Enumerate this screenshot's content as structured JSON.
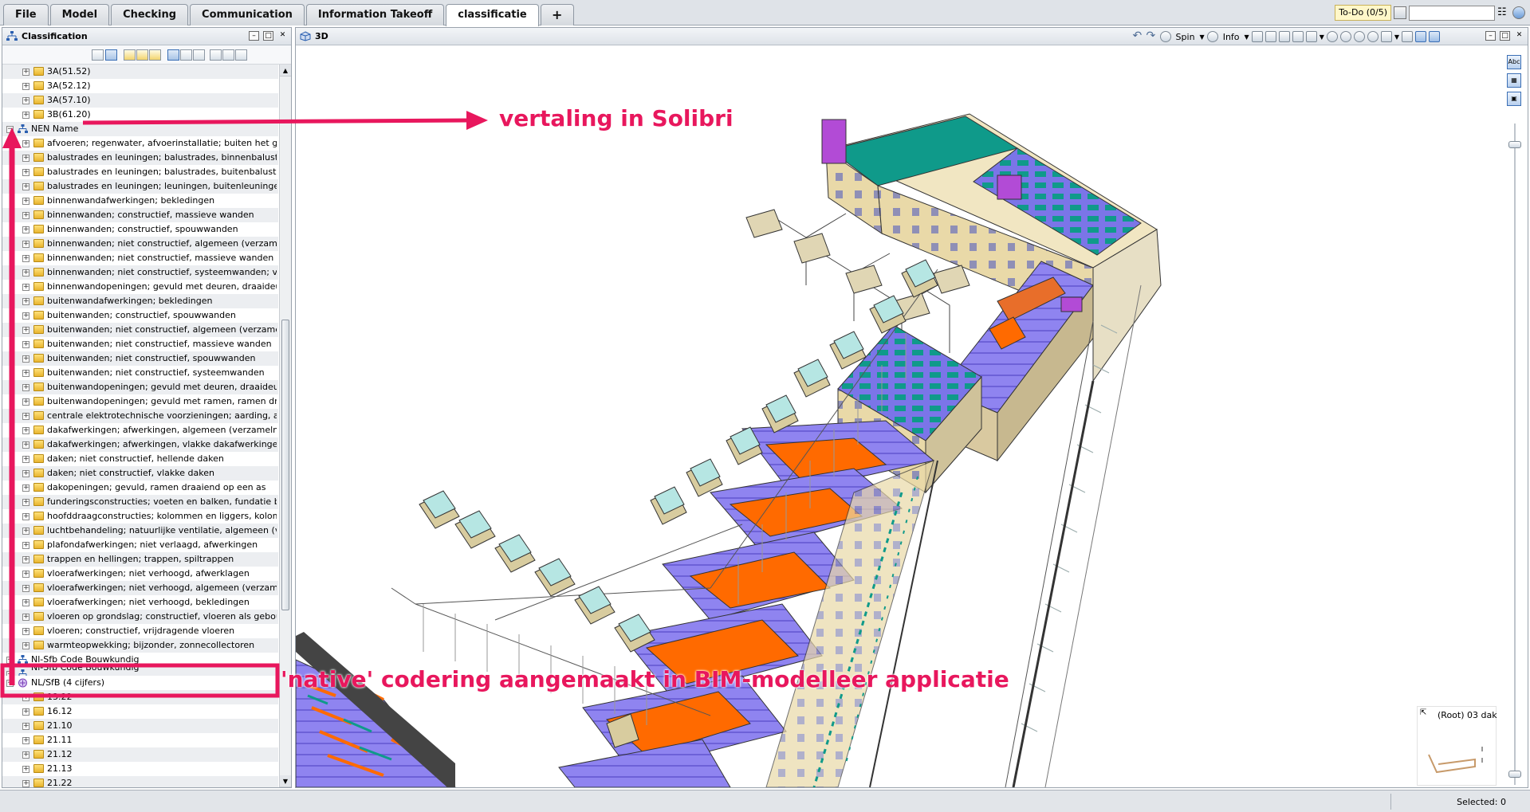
{
  "tabs": [
    {
      "label": "File"
    },
    {
      "label": "Model"
    },
    {
      "label": "Checking"
    },
    {
      "label": "Communication"
    },
    {
      "label": "Information Takeoff"
    },
    {
      "label": "classificatie"
    },
    {
      "label": "+"
    }
  ],
  "active_tab": "classificatie",
  "topright": {
    "todo_label": "To-Do (0/5)",
    "search_value": ""
  },
  "left_panel": {
    "title": "Classification"
  },
  "view_panel": {
    "title": "3D",
    "spin_label": "Spin",
    "info_label": "Info",
    "minimap_label": "(Root) 03 dak"
  },
  "tree": [
    {
      "level": 1,
      "label": "3A(51.52)",
      "type": "folder"
    },
    {
      "level": 1,
      "label": "3A(52.12)",
      "type": "folder"
    },
    {
      "level": 1,
      "label": "3A(57.10)",
      "type": "folder"
    },
    {
      "level": 1,
      "label": "3B(61.20)",
      "type": "folder"
    },
    {
      "level": 0,
      "label": "NEN Name",
      "type": "classification",
      "expanded": true
    },
    {
      "level": 1,
      "label": "afvoeren; regenwater, afvoerinstallatie; buiten het geb",
      "type": "folder"
    },
    {
      "level": 1,
      "label": "balustrades en leuningen; balustrades, binnenbalustrad",
      "type": "folder"
    },
    {
      "level": 1,
      "label": "balustrades en leuningen; balustrades, buitenbalustrad",
      "type": "folder"
    },
    {
      "level": 1,
      "label": "balustrades en leuningen; leuningen, buitenleuningen",
      "type": "folder"
    },
    {
      "level": 1,
      "label": "binnenwandafwerkingen; bekledingen",
      "type": "folder"
    },
    {
      "level": 1,
      "label": "binnenwanden; constructief, massieve wanden",
      "type": "folder"
    },
    {
      "level": 1,
      "label": "binnenwanden; constructief, spouwwanden",
      "type": "folder"
    },
    {
      "level": 1,
      "label": "binnenwanden; niet constructief, algemeen (verzamelni",
      "type": "folder"
    },
    {
      "level": 1,
      "label": "binnenwanden; niet constructief, massieve wanden",
      "type": "folder"
    },
    {
      "level": 1,
      "label": "binnenwanden; niet constructief, systeemwanden; vast",
      "type": "folder"
    },
    {
      "level": 1,
      "label": "binnenwandopeningen; gevuld met deuren, draaideuren",
      "type": "folder"
    },
    {
      "level": 1,
      "label": "buitenwandafwerkingen; bekledingen",
      "type": "folder"
    },
    {
      "level": 1,
      "label": "buitenwanden; constructief, spouwwanden",
      "type": "folder"
    },
    {
      "level": 1,
      "label": "buitenwanden; niet constructief, algemeen (verzamelni",
      "type": "folder"
    },
    {
      "level": 1,
      "label": "buitenwanden; niet constructief, massieve wanden",
      "type": "folder"
    },
    {
      "level": 1,
      "label": "buitenwanden; niet constructief, spouwwanden",
      "type": "folder"
    },
    {
      "level": 1,
      "label": "buitenwanden; niet constructief, systeemwanden",
      "type": "folder"
    },
    {
      "level": 1,
      "label": "buitenwandopeningen; gevuld met deuren, draaideuren",
      "type": "folder"
    },
    {
      "level": 1,
      "label": "buitenwandopeningen; gevuld met ramen, ramen draaie",
      "type": "folder"
    },
    {
      "level": 1,
      "label": "centrale elektrotechnische voorzieningen; aarding, alge",
      "type": "folder"
    },
    {
      "level": 1,
      "label": "dakafwerkingen; afwerkingen, algemeen (verzamelnive",
      "type": "folder"
    },
    {
      "level": 1,
      "label": "dakafwerkingen; afwerkingen, vlakke dakafwerkingen",
      "type": "folder"
    },
    {
      "level": 1,
      "label": "daken; niet constructief, hellende daken",
      "type": "folder"
    },
    {
      "level": 1,
      "label": "daken; niet constructief, vlakke daken",
      "type": "folder"
    },
    {
      "level": 1,
      "label": "dakopeningen; gevuld, ramen draaiend op een as",
      "type": "folder"
    },
    {
      "level": 1,
      "label": "funderingsconstructies; voeten en balken, fundatie balk",
      "type": "folder"
    },
    {
      "level": 1,
      "label": "hoofddraagconstructies; kolommen en liggers, kolom-/lig",
      "type": "folder"
    },
    {
      "level": 1,
      "label": "luchtbehandeling; natuurlijke ventilatie, algemeen (verz",
      "type": "folder"
    },
    {
      "level": 1,
      "label": "plafondafwerkingen; niet verlaagd, afwerkingen",
      "type": "folder"
    },
    {
      "level": 1,
      "label": "trappen en hellingen; trappen, spiltrappen",
      "type": "folder"
    },
    {
      "level": 1,
      "label": "vloerafwerkingen; niet verhoogd, afwerklagen",
      "type": "folder"
    },
    {
      "level": 1,
      "label": "vloerafwerkingen; niet verhoogd, algemeen (verzamelni",
      "type": "folder"
    },
    {
      "level": 1,
      "label": "vloerafwerkingen; niet verhoogd, bekledingen",
      "type": "folder"
    },
    {
      "level": 1,
      "label": "vloeren op grondslag; constructief, vloeren als gebouw",
      "type": "folder"
    },
    {
      "level": 1,
      "label": "vloeren; constructief, vrijdragende vloeren",
      "type": "folder"
    },
    {
      "level": 1,
      "label": "warmteopwekking; bijzonder, zonnecollectoren",
      "type": "folder"
    },
    {
      "level": 0,
      "label": "Nl-Sfb Code Bouwkundig",
      "type": "classification",
      "expanded": false
    },
    {
      "level": 0,
      "label": "Nl-Sfb Code Bouwkundig",
      "type": "classification",
      "expanded": false,
      "partial": true
    },
    {
      "level": 0,
      "label": "NL/SfB (4 cijfers)",
      "type": "native",
      "expanded": true
    },
    {
      "level": 1,
      "label": "13.22",
      "type": "folder"
    },
    {
      "level": 1,
      "label": "16.12",
      "type": "folder"
    },
    {
      "level": 1,
      "label": "21.10",
      "type": "folder"
    },
    {
      "level": 1,
      "label": "21.11",
      "type": "folder"
    },
    {
      "level": 1,
      "label": "21.12",
      "type": "folder"
    },
    {
      "level": 1,
      "label": "21.13",
      "type": "folder"
    },
    {
      "level": 1,
      "label": "21.22",
      "type": "folder"
    }
  ],
  "status": {
    "selected_label": "Selected: 0"
  },
  "annotations": {
    "translation": "vertaling in Solibri",
    "native": "'native'  codering aangemaakt in BIM-modelleer applicatie"
  },
  "colors": {
    "annotation": "#e8175d",
    "roof_orange": "#ff6a00",
    "wall_purple": "#8f84f0",
    "roof_teal": "#0f9a8a"
  }
}
